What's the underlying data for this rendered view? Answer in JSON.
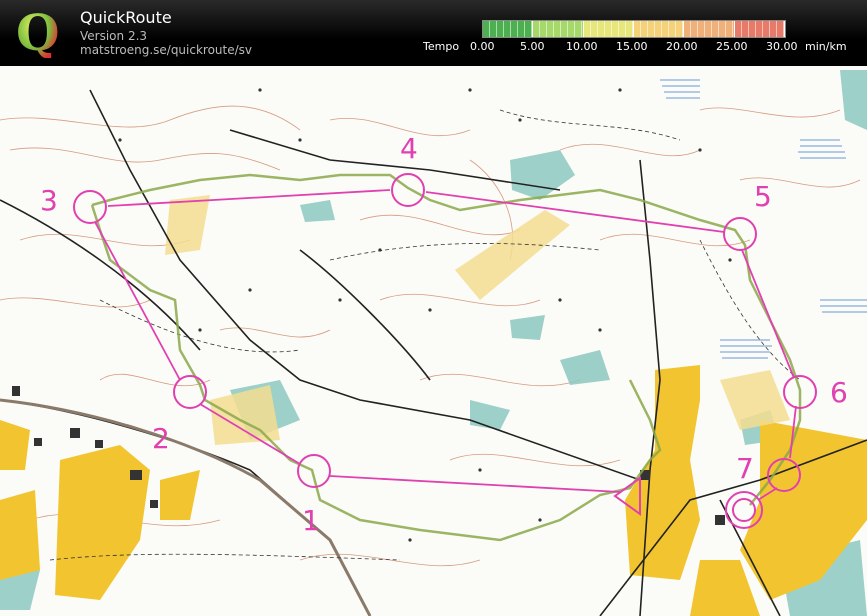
{
  "app": {
    "title": "QuickRoute",
    "version": "Version 2.3",
    "url": "matstroeng.se/quickroute/sv",
    "logo_letter": "Q"
  },
  "legend": {
    "label": "Tempo",
    "unit": "min/km",
    "ticks": [
      "0.00",
      "5.00",
      "10.00",
      "15.00",
      "20.00",
      "25.00",
      "30.00"
    ],
    "colors": [
      "#4caf50",
      "#a6d86a",
      "#e6e67a",
      "#f5d27a",
      "#f0b07a",
      "#e87a6a"
    ]
  },
  "map": {
    "controls": [
      {
        "label": "1",
        "type": "control"
      },
      {
        "label": "2",
        "type": "control"
      },
      {
        "label": "3",
        "type": "control"
      },
      {
        "label": "4",
        "type": "control"
      },
      {
        "label": "5",
        "type": "control"
      },
      {
        "label": "6",
        "type": "control"
      },
      {
        "label": "7",
        "type": "control"
      },
      {
        "label": "",
        "type": "finish"
      }
    ],
    "colors": {
      "course": "#e040b0",
      "route": "#8aa84a",
      "open_land": "#f2c530",
      "vegetation": "#8cc8c0",
      "contour": "#c8724a",
      "road": "#222222"
    }
  }
}
